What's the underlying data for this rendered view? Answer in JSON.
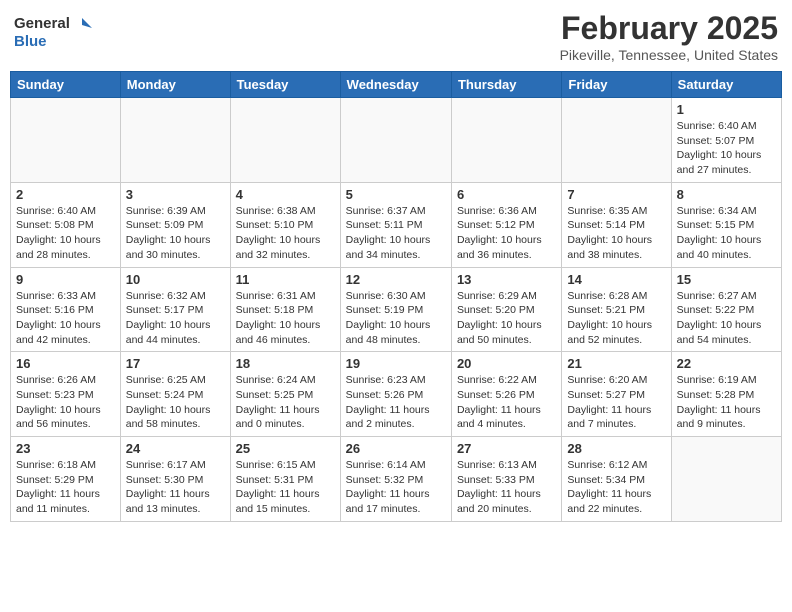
{
  "header": {
    "logo_general": "General",
    "logo_blue": "Blue",
    "month_title": "February 2025",
    "location": "Pikeville, Tennessee, United States"
  },
  "days_of_week": [
    "Sunday",
    "Monday",
    "Tuesday",
    "Wednesday",
    "Thursday",
    "Friday",
    "Saturday"
  ],
  "weeks": [
    [
      {
        "day": "",
        "info": ""
      },
      {
        "day": "",
        "info": ""
      },
      {
        "day": "",
        "info": ""
      },
      {
        "day": "",
        "info": ""
      },
      {
        "day": "",
        "info": ""
      },
      {
        "day": "",
        "info": ""
      },
      {
        "day": "1",
        "info": "Sunrise: 6:40 AM\nSunset: 5:07 PM\nDaylight: 10 hours and 27 minutes."
      }
    ],
    [
      {
        "day": "2",
        "info": "Sunrise: 6:40 AM\nSunset: 5:08 PM\nDaylight: 10 hours and 28 minutes."
      },
      {
        "day": "3",
        "info": "Sunrise: 6:39 AM\nSunset: 5:09 PM\nDaylight: 10 hours and 30 minutes."
      },
      {
        "day": "4",
        "info": "Sunrise: 6:38 AM\nSunset: 5:10 PM\nDaylight: 10 hours and 32 minutes."
      },
      {
        "day": "5",
        "info": "Sunrise: 6:37 AM\nSunset: 5:11 PM\nDaylight: 10 hours and 34 minutes."
      },
      {
        "day": "6",
        "info": "Sunrise: 6:36 AM\nSunset: 5:12 PM\nDaylight: 10 hours and 36 minutes."
      },
      {
        "day": "7",
        "info": "Sunrise: 6:35 AM\nSunset: 5:14 PM\nDaylight: 10 hours and 38 minutes."
      },
      {
        "day": "8",
        "info": "Sunrise: 6:34 AM\nSunset: 5:15 PM\nDaylight: 10 hours and 40 minutes."
      }
    ],
    [
      {
        "day": "9",
        "info": "Sunrise: 6:33 AM\nSunset: 5:16 PM\nDaylight: 10 hours and 42 minutes."
      },
      {
        "day": "10",
        "info": "Sunrise: 6:32 AM\nSunset: 5:17 PM\nDaylight: 10 hours and 44 minutes."
      },
      {
        "day": "11",
        "info": "Sunrise: 6:31 AM\nSunset: 5:18 PM\nDaylight: 10 hours and 46 minutes."
      },
      {
        "day": "12",
        "info": "Sunrise: 6:30 AM\nSunset: 5:19 PM\nDaylight: 10 hours and 48 minutes."
      },
      {
        "day": "13",
        "info": "Sunrise: 6:29 AM\nSunset: 5:20 PM\nDaylight: 10 hours and 50 minutes."
      },
      {
        "day": "14",
        "info": "Sunrise: 6:28 AM\nSunset: 5:21 PM\nDaylight: 10 hours and 52 minutes."
      },
      {
        "day": "15",
        "info": "Sunrise: 6:27 AM\nSunset: 5:22 PM\nDaylight: 10 hours and 54 minutes."
      }
    ],
    [
      {
        "day": "16",
        "info": "Sunrise: 6:26 AM\nSunset: 5:23 PM\nDaylight: 10 hours and 56 minutes."
      },
      {
        "day": "17",
        "info": "Sunrise: 6:25 AM\nSunset: 5:24 PM\nDaylight: 10 hours and 58 minutes."
      },
      {
        "day": "18",
        "info": "Sunrise: 6:24 AM\nSunset: 5:25 PM\nDaylight: 11 hours and 0 minutes."
      },
      {
        "day": "19",
        "info": "Sunrise: 6:23 AM\nSunset: 5:26 PM\nDaylight: 11 hours and 2 minutes."
      },
      {
        "day": "20",
        "info": "Sunrise: 6:22 AM\nSunset: 5:26 PM\nDaylight: 11 hours and 4 minutes."
      },
      {
        "day": "21",
        "info": "Sunrise: 6:20 AM\nSunset: 5:27 PM\nDaylight: 11 hours and 7 minutes."
      },
      {
        "day": "22",
        "info": "Sunrise: 6:19 AM\nSunset: 5:28 PM\nDaylight: 11 hours and 9 minutes."
      }
    ],
    [
      {
        "day": "23",
        "info": "Sunrise: 6:18 AM\nSunset: 5:29 PM\nDaylight: 11 hours and 11 minutes."
      },
      {
        "day": "24",
        "info": "Sunrise: 6:17 AM\nSunset: 5:30 PM\nDaylight: 11 hours and 13 minutes."
      },
      {
        "day": "25",
        "info": "Sunrise: 6:15 AM\nSunset: 5:31 PM\nDaylight: 11 hours and 15 minutes."
      },
      {
        "day": "26",
        "info": "Sunrise: 6:14 AM\nSunset: 5:32 PM\nDaylight: 11 hours and 17 minutes."
      },
      {
        "day": "27",
        "info": "Sunrise: 6:13 AM\nSunset: 5:33 PM\nDaylight: 11 hours and 20 minutes."
      },
      {
        "day": "28",
        "info": "Sunrise: 6:12 AM\nSunset: 5:34 PM\nDaylight: 11 hours and 22 minutes."
      },
      {
        "day": "",
        "info": ""
      }
    ]
  ]
}
